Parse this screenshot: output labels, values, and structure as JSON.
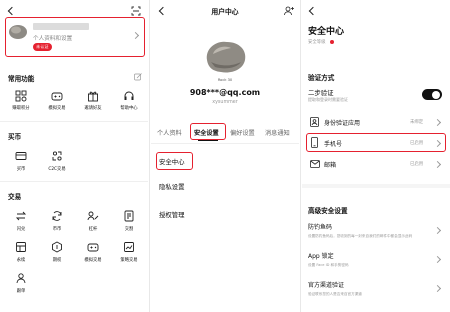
{
  "panel1": {
    "profile_sub": "个人资料和设置",
    "badge": "未认证",
    "common_title": "常用功能",
    "common_items": [
      "赚取积分",
      "模拟交易",
      "邀请好友",
      "帮助中心"
    ],
    "buy_title": "买币",
    "buy_items": [
      "买币",
      "C2C交易"
    ],
    "trade_title": "交易",
    "trade_items": [
      "闪兑",
      "币币",
      "杠杆",
      "交割",
      "永续",
      "期权",
      "模拟交易",
      "策略交易",
      "跟单"
    ]
  },
  "panel2": {
    "title": "用户中心",
    "avatar_tag": "Rock 30",
    "email": "908***@qq.com",
    "username": "xysummer",
    "tabs": [
      "个人资料",
      "安全设置",
      "偏好设置",
      "消息通知"
    ],
    "menu": [
      "安全中心",
      "隐私设置",
      "授权管理"
    ]
  },
  "panel3": {
    "title": "安全中心",
    "level_label": "安全等级",
    "verify_title": "验证方式",
    "twostep_label": "二步验证",
    "twostep_desc": "提取和登录时需要验证",
    "rows": [
      {
        "label": "身份验证应用",
        "status": "未绑定"
      },
      {
        "label": "手机号",
        "status": "已启用"
      },
      {
        "label": "邮箱",
        "status": "已启用"
      }
    ],
    "advanced_title": "高级安全设置",
    "adv_rows": [
      {
        "label": "防钓鱼码",
        "desc": "设置防钓鱼码后，您收到的每一封来自我们的邮件中都会显示此码"
      },
      {
        "label": "App 锁定",
        "desc": "设置 Face ID 和手势密码"
      },
      {
        "label": "官方渠道验证",
        "desc": "验证联系您的人是否来自官方渠道"
      }
    ]
  },
  "colors": {
    "accent": "#e5212f",
    "toggle": "#111111"
  }
}
